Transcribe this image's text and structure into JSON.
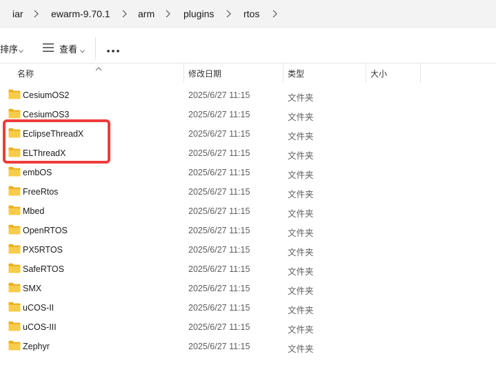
{
  "breadcrumb": {
    "items": [
      "iar",
      "ewarm-9.70.1",
      "arm",
      "plugins",
      "rtos"
    ]
  },
  "toolbar": {
    "sort_label": "排序",
    "view_label": "查看",
    "more_label": "..."
  },
  "columns": {
    "name": "名称",
    "date": "修改日期",
    "type": "类型",
    "size": "大小"
  },
  "files": [
    {
      "name": "CesiumOS2",
      "date": "2025/6/27 11:15",
      "type": "文件夹"
    },
    {
      "name": "CesiumOS3",
      "date": "2025/6/27 11:15",
      "type": "文件夹"
    },
    {
      "name": "EclipseThreadX",
      "date": "2025/6/27 11:15",
      "type": "文件夹"
    },
    {
      "name": "ELThreadX",
      "date": "2025/6/27 11:15",
      "type": "文件夹"
    },
    {
      "name": "embOS",
      "date": "2025/6/27 11:15",
      "type": "文件夹"
    },
    {
      "name": "FreeRtos",
      "date": "2025/6/27 11:15",
      "type": "文件夹"
    },
    {
      "name": "Mbed",
      "date": "2025/6/27 11:15",
      "type": "文件夹"
    },
    {
      "name": "OpenRTOS",
      "date": "2025/6/27 11:15",
      "type": "文件夹"
    },
    {
      "name": "PX5RTOS",
      "date": "2025/6/27 11:15",
      "type": "文件夹"
    },
    {
      "name": "SafeRTOS",
      "date": "2025/6/27 11:15",
      "type": "文件夹"
    },
    {
      "name": "SMX",
      "date": "2025/6/27 11:15",
      "type": "文件夹"
    },
    {
      "name": "uCOS-II",
      "date": "2025/6/27 11:15",
      "type": "文件夹"
    },
    {
      "name": "uCOS-III",
      "date": "2025/6/27 11:15",
      "type": "文件夹"
    },
    {
      "name": "Zephyr",
      "date": "2025/6/27 11:15",
      "type": "文件夹"
    }
  ],
  "colors": {
    "highlight": "#ef3c3c",
    "folder": "#f4c542"
  },
  "icons": {
    "folder": "folder-icon",
    "separator": "chevron-right-icon",
    "view": "list-view-icon",
    "more": "more-icon",
    "caret": "chevron-down-icon",
    "sort": "sort-up-icon"
  }
}
